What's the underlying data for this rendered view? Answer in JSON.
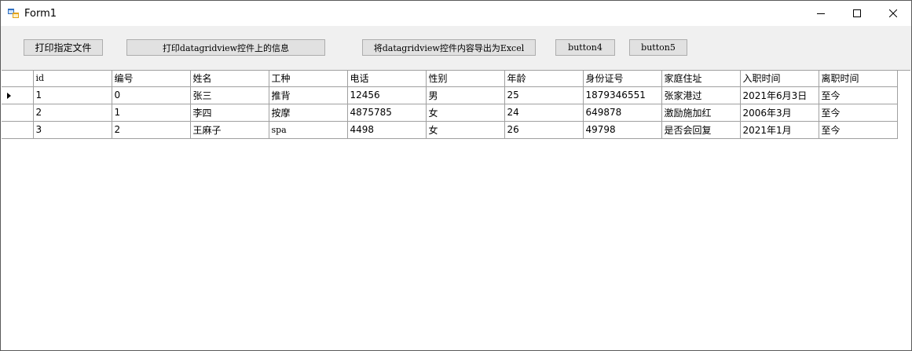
{
  "window": {
    "title": "Form1"
  },
  "toolbar": {
    "buttons": [
      "打印指定文件",
      "打印datagridview控件上的信息",
      "将datagridview控件内容导出为Excel",
      "button4",
      "button5"
    ]
  },
  "grid": {
    "columns": [
      "id",
      "编号",
      "姓名",
      "工种",
      "电话",
      "性别",
      "年龄",
      "身份证号",
      "家庭住址",
      "入职时间",
      "离职时间"
    ],
    "rows": [
      [
        "1",
        "0",
        "张三",
        "推背",
        "12456",
        "男",
        "25",
        "1879346551",
        "张家港过",
        "2021年6月3日",
        "至今"
      ],
      [
        "2",
        "1",
        "李四",
        "按摩",
        "4875785",
        "女",
        "24",
        "649878",
        "激励施加红",
        "2006年3月",
        "至今"
      ],
      [
        "3",
        "2",
        "王麻子",
        "spa",
        "4498",
        "女",
        "26",
        "49798",
        "是否会回复",
        "2021年1月",
        "至今"
      ]
    ]
  }
}
